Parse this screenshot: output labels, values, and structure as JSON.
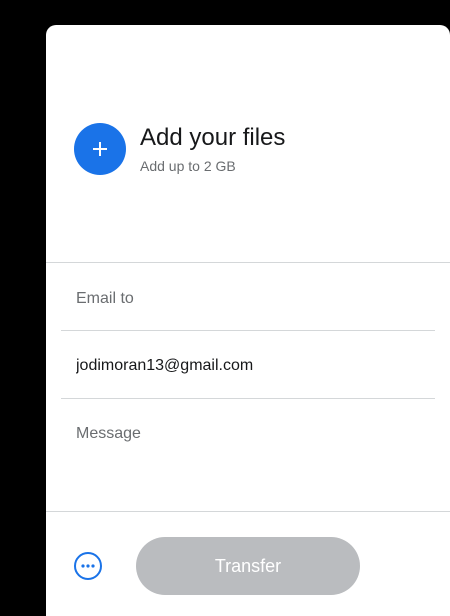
{
  "upload": {
    "add_icon": "plus-icon",
    "title": "Add your files",
    "subtitle": "Add up to 2 GB"
  },
  "form": {
    "email_to_placeholder": "Email to",
    "your_email_value": "jodimoran13@gmail.com",
    "message_placeholder": "Message"
  },
  "footer": {
    "more_icon": "more-options-icon",
    "transfer_label": "Transfer"
  },
  "colors": {
    "accent": "#1a73e8",
    "disabled_button": "#babcbf",
    "background": "#000000",
    "panel": "#ffffff"
  }
}
